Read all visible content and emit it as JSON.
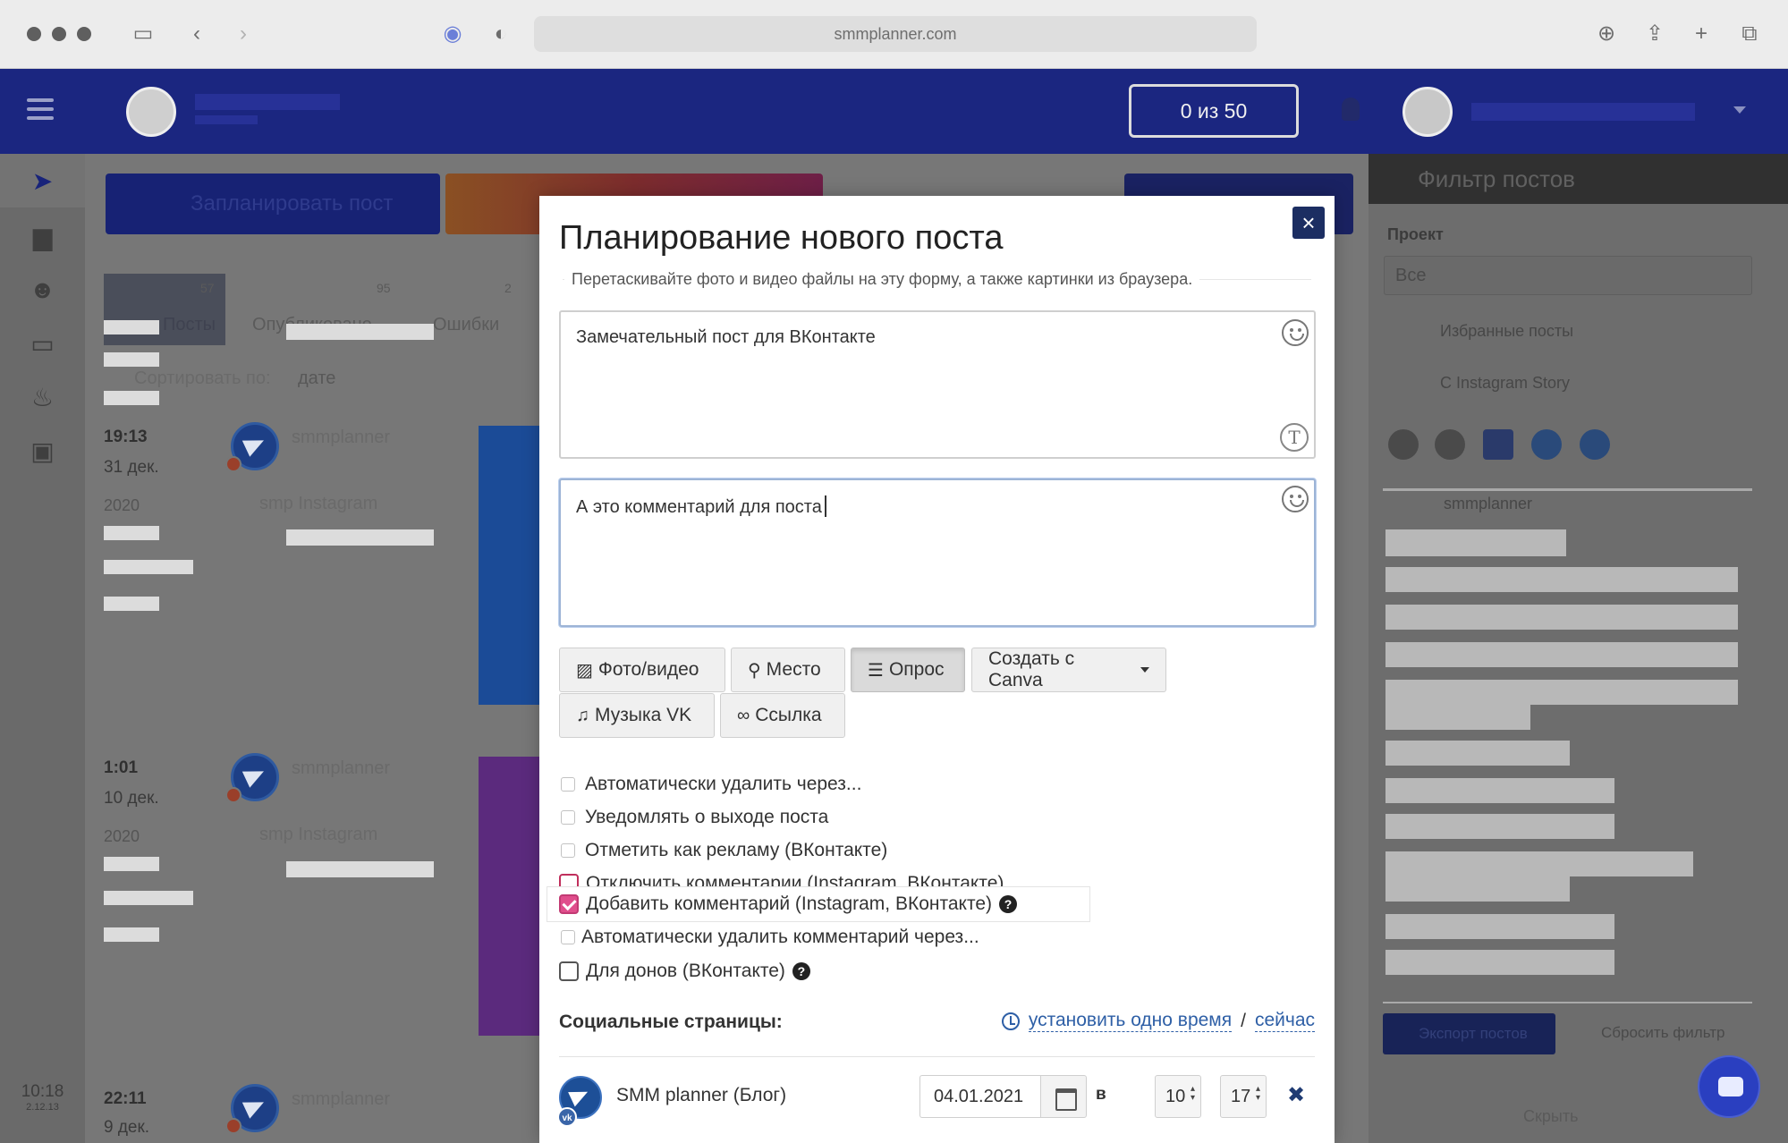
{
  "browser": {
    "url": "smmplanner.com"
  },
  "header": {
    "quota": "0 из 50"
  },
  "sidebar": {
    "time": "10:18",
    "date": "2.12.13"
  },
  "background": {
    "plan_button": "Запланировать пост",
    "tabs": [
      {
        "label": "Посты",
        "count": "57"
      },
      {
        "label": "Опубликовано",
        "count": "95"
      },
      {
        "label": "Ошибки",
        "count": "2"
      }
    ],
    "sort_label": "Сортировать по:",
    "sort_value": "дате",
    "timeline": [
      {
        "time": "19:13",
        "date": "31 дек.",
        "year": "2020",
        "account": "smmplanner",
        "sub": "smp Instagram"
      },
      {
        "time": "1:01",
        "date": "10 дек.",
        "year": "2020",
        "account": "smmplanner",
        "sub": "smp Instagram"
      },
      {
        "time": "22:11",
        "date": "9 дек.",
        "year": "",
        "account": "smmplanner",
        "sub": ""
      }
    ]
  },
  "filter_panel": {
    "title": "Фильтр постов",
    "project_label": "Проект",
    "project_value": "Все",
    "favorites": "Избранные посты",
    "stories": "С Instagram Story",
    "account": "smmplanner",
    "export_button": "Экспорт постов",
    "reset_button": "Сбросить фильтр",
    "hide_link": "Скрыть"
  },
  "modal": {
    "title": "Планирование нового поста",
    "drop_hint": "Перетаскивайте фото и видео файлы на эту форму, а также картинки из браузера.",
    "post_text": "Замечательный пост для ВКонтакте",
    "comment_text": "А это комментарий для поста",
    "buttons": {
      "photo": "Фото/видео",
      "place": "Место",
      "poll": "Опрос",
      "canva": "Создать с Canva",
      "music": "Музыка VK",
      "link": "Ссылка"
    },
    "options": [
      "Автоматически удалить через...",
      "Уведомлять о выходе поста",
      "Отметить как рекламу (ВКонтакте)",
      "Отключить комментарии (Instagram, ВКонтакте)",
      "Добавить комментарий (Instagram, ВКонтакте)",
      "Автоматически удалить комментарий через...",
      "Для донов (ВКонтакте)"
    ],
    "social_title": "Социальные страницы:",
    "set_time_link": "установить одно время",
    "now_link": "сейчас",
    "social_page": {
      "name": "SMM planner (Блог)",
      "network_badge": "vk",
      "date": "04.01.2021",
      "at": "в",
      "hour": "10",
      "minute": "17"
    }
  },
  "colors": {
    "accent_header": "#1b2680",
    "checkbox_checked": "#e04e8c",
    "link": "#2e5fa6",
    "close_button": "#1c2e62"
  }
}
